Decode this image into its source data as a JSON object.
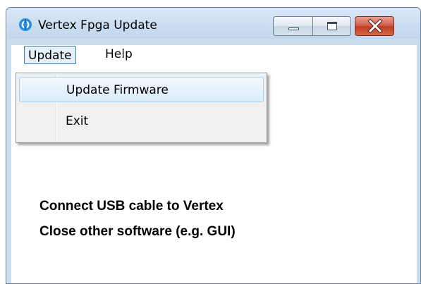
{
  "window": {
    "title": "Vertex Fpga Update",
    "app_icon": "app-logo-icon",
    "controls": [
      "minimize-icon",
      "maximize-icon",
      "close-icon"
    ]
  },
  "menubar": {
    "items": [
      {
        "label": "Update"
      },
      {
        "label": "Help"
      }
    ]
  },
  "dropdown": {
    "items": [
      {
        "label": "Update Firmware"
      },
      {
        "label": "Exit"
      }
    ]
  },
  "content": {
    "messages": [
      "Connect USB cable to Vertex",
      "Close other software (e.g. GUI)"
    ]
  },
  "colors": {
    "titlebar": "#c9ddef",
    "close_button": "#c9442d",
    "menu_highlight": "#e5f1fb",
    "app_icon": "#2a8ee0"
  }
}
